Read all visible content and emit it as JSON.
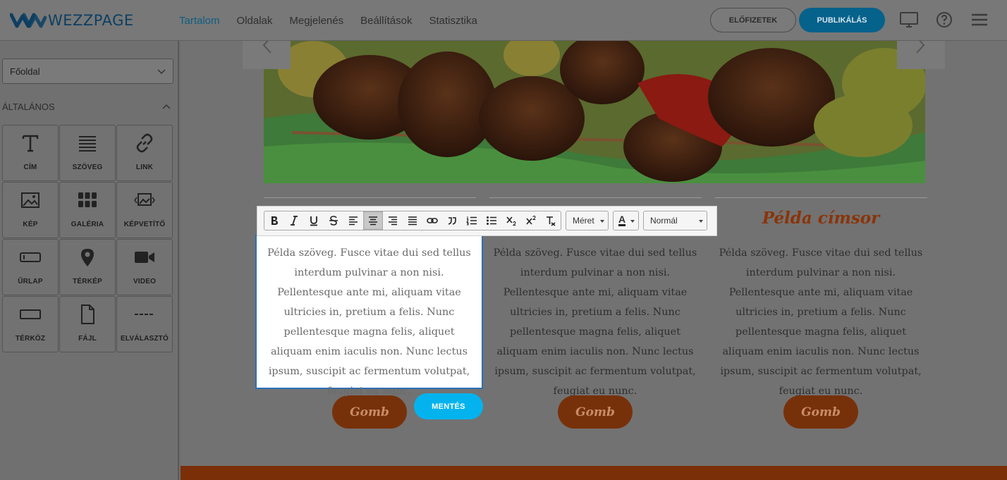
{
  "app": {
    "logo_text": "WEZZPAGE"
  },
  "nav": [
    "Tartalom",
    "Oldalak",
    "Megjelenés",
    "Beállítások",
    "Statisztika"
  ],
  "header_buttons": {
    "subscriptions": "ELŐFIZETEK",
    "publish": "PUBLIKÁLÁS"
  },
  "header_icons": [
    "monitor-icon",
    "help-icon",
    "menu-icon"
  ],
  "sidebar": {
    "page_select": "Főoldal",
    "section_title": "ÁLTALÁNOS",
    "tiles": [
      {
        "label": "CÍM",
        "icon": "title-icon"
      },
      {
        "label": "SZÖVEG",
        "icon": "text-icon"
      },
      {
        "label": "LINK",
        "icon": "link-icon"
      },
      {
        "label": "KÉP",
        "icon": "image-icon"
      },
      {
        "label": "GALÉRIA",
        "icon": "gallery-icon"
      },
      {
        "label": "KÉPVETÍTŐ",
        "icon": "slideshow-icon"
      },
      {
        "label": "ŰRLAP",
        "icon": "form-icon"
      },
      {
        "label": "TÉRKÉP",
        "icon": "map-pin-icon"
      },
      {
        "label": "VIDEO",
        "icon": "video-icon"
      },
      {
        "label": "TÉRKÖZ",
        "icon": "spacer-icon"
      },
      {
        "label": "FÁJL",
        "icon": "file-icon"
      },
      {
        "label": "ELVÁLASZTÓ",
        "icon": "divider-icon"
      }
    ]
  },
  "toolbar": {
    "buttons": [
      "bold",
      "italic",
      "underline",
      "strikethrough",
      "align-left",
      "align-center",
      "align-right",
      "align-justify",
      "link",
      "blockquote",
      "ordered-list",
      "bullet-list",
      "subscript",
      "superscript",
      "clear-format"
    ],
    "active": "align-center",
    "size_label": "Méret",
    "color_label": "A",
    "format_label": "Normál"
  },
  "content": {
    "paragraph": "Példa szöveg. Fusce vitae dui sed tellus interdum pulvinar a non nisi. Pellentesque ante mi, aliquam vitae ultricies in, pretium a felis. Nunc pellentesque magna felis, aliquet aliquam enim iaculis non. Nunc lectus ipsum, suscipit ac fermentum volutpat, feugiat eu nunc.",
    "heading": "Példa címsor",
    "button_label": "Gomb",
    "save_label": "MENTÉS"
  },
  "colors": {
    "accent": "#04b3ed",
    "brand": "#0d3f62",
    "orange": "#b5510f"
  }
}
